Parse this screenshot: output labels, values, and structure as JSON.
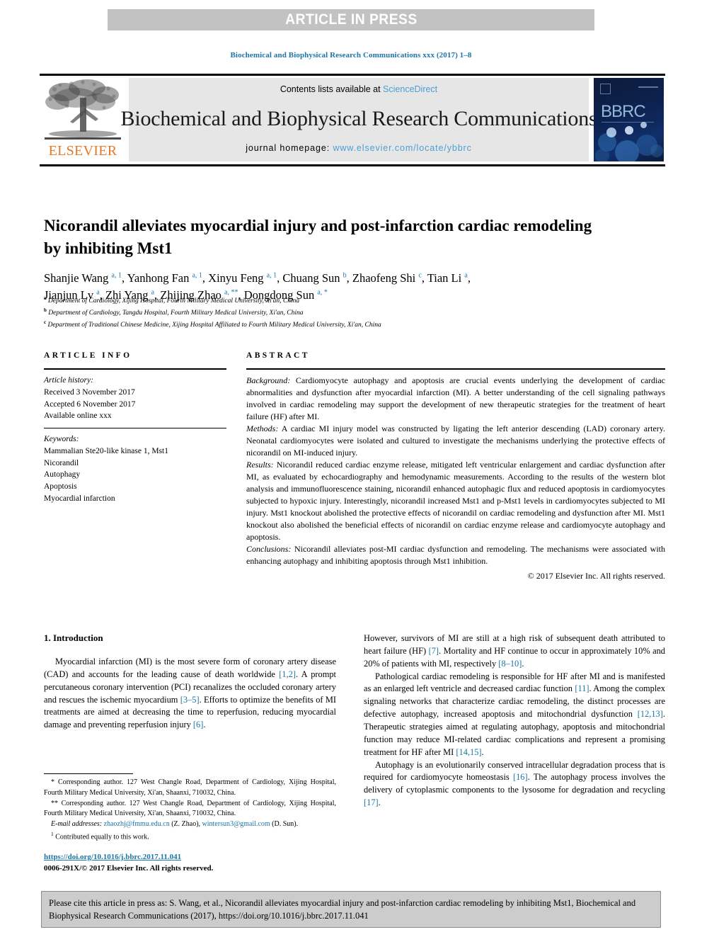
{
  "banner": {
    "label": "ARTICLE IN PRESS"
  },
  "running_head": "Biochemical and Biophysical Research Communications xxx (2017) 1–8",
  "masthead": {
    "elsevier_wordmark": "ELSEVIER",
    "contents_prefix": "Contents lists available at ",
    "contents_link": "ScienceDirect",
    "journal_title": "Biochemical and Biophysical Research Communications",
    "homepage_prefix": "journal homepage: ",
    "homepage_url": "www.elsevier.com/locate/ybbrc",
    "cover_label": "BBRC"
  },
  "article": {
    "title": "Nicorandil alleviates myocardial injury and post-infarction cardiac remodeling by inhibiting Mst1",
    "authors_line_1": "Shanjie Wang <sup>a, 1</sup>, Yanhong Fan <sup>a, 1</sup>, Xinyu Feng <sup>a, 1</sup>, Chuang Sun <sup>b</sup>, Zhaofeng Shi <sup>c</sup>, Tian Li <sup>a</sup>,",
    "authors_line_2": "Jianjun Lv <sup>a</sup>, Zhi Yang <sup>a</sup>, Zhijing Zhao <sup>a, **</sup>, Dongdong Sun <sup>a, *</sup>",
    "affiliation_a": "<sup>a</sup> Department of Cardiology, Xijing Hospital, Fourth Military Medical University, Xi'an, China",
    "affiliation_b": "<sup>b</sup> Department of Cardiology, Tangdu Hospital, Fourth Military Medical University, Xi'an, China",
    "affiliation_c": "<sup>c</sup> Department of Traditional Chinese Medicine, Xijing Hospital Affiliated to Fourth Military Medical University, Xi'an, China"
  },
  "article_info": {
    "heading": "ARTICLE INFO",
    "history_label": "Article history:",
    "received": "Received 3 November 2017",
    "accepted": "Accepted 6 November 2017",
    "available": "Available online xxx",
    "keywords_label": "Keywords:",
    "keywords": [
      "Mammalian Ste20-like kinase 1, Mst1",
      "Nicorandil",
      "Autophagy",
      "Apoptosis",
      "Myocardial infarction"
    ]
  },
  "abstract": {
    "heading": "ABSTRACT",
    "background_label": "Background:",
    "background": "Cardiomyocyte autophagy and apoptosis are crucial events underlying the development of cardiac abnormalities and dysfunction after myocardial infarction (MI). A better understanding of the cell signaling pathways involved in cardiac remodeling may support the development of new therapeutic strategies for the treatment of heart failure (HF) after MI.",
    "methods_label": "Methods:",
    "methods": "A cardiac MI injury model was constructed by ligating the left anterior descending (LAD) coronary artery. Neonatal cardiomyocytes were isolated and cultured to investigate the mechanisms underlying the protective effects of nicorandil on MI-induced injury.",
    "results_label": "Results:",
    "results": "Nicorandil reduced cardiac enzyme release, mitigated left ventricular enlargement and cardiac dysfunction after MI, as evaluated by echocardiography and hemodynamic measurements. According to the results of the western blot analysis and immunofluorescence staining, nicorandil enhanced autophagic flux and reduced apoptosis in cardiomyocytes subjected to hypoxic injury. Interestingly, nicorandil increased Mst1 and p-Mst1 levels in cardiomyocytes subjected to MI injury. Mst1 knockout abolished the protective effects of nicorandil on cardiac remodeling and dysfunction after MI. Mst1 knockout also abolished the beneficial effects of nicorandil on cardiac enzyme release and cardiomyocyte autophagy and apoptosis.",
    "conclusions_label": "Conclusions:",
    "conclusions": "Nicorandil alleviates post-MI cardiac dysfunction and remodeling. The mechanisms were associated with enhancing autophagy and inhibiting apoptosis through Mst1 inhibition.",
    "copyright": "© 2017 Elsevier Inc. All rights reserved."
  },
  "introduction": {
    "heading": "1. Introduction",
    "left_p1_a": "Myocardial infarction (MI) is the most severe form of coronary artery disease (CAD) and accounts for the leading cause of death worldwide ",
    "left_p1_ref1": "[1,2]",
    "left_p1_b": ". A prompt percutaneous coronary intervention (PCI) recanalizes the occluded coronary artery and rescues the ischemic myocardium ",
    "left_p1_ref2": "[3–5]",
    "left_p1_c": ". Efforts to optimize the benefits of MI treatments are aimed at decreasing the time to reperfusion, reducing myocardial damage and preventing reperfusion injury ",
    "left_p1_ref3": "[6]",
    "left_p1_d": ".",
    "right_p1_a": "However, survivors of MI are still at a high risk of subsequent death attributed to heart failure (HF) ",
    "right_p1_ref1": "[7]",
    "right_p1_b": ". Mortality and HF continue to occur in approximately 10% and 20% of patients with MI, respectively ",
    "right_p1_ref2": "[8–10]",
    "right_p1_c": ".",
    "right_p2_a": "Pathological cardiac remodeling is responsible for HF after MI and is manifested as an enlarged left ventricle and decreased cardiac function ",
    "right_p2_ref1": "[11]",
    "right_p2_b": ". Among the complex signaling networks that characterize cardiac remodeling, the distinct processes are defective autophagy, increased apoptosis and mitochondrial dysfunction ",
    "right_p2_ref2": "[12,13]",
    "right_p2_c": ". Therapeutic strategies aimed at regulating autophagy, apoptosis and mitochondrial function may reduce MI-related cardiac complications and represent a promising treatment for HF after MI ",
    "right_p2_ref3": "[14,15]",
    "right_p2_d": ".",
    "right_p3_a": "Autophagy is an evolutionarily conserved intracellular degradation process that is required for cardiomyocyte homeostasis ",
    "right_p3_ref1": "[16]",
    "right_p3_b": ". The autophagy process involves the delivery of cytoplasmic components to the lysosome for degradation and recycling ",
    "right_p3_ref2": "[17]",
    "right_p3_c": "."
  },
  "footnotes": {
    "corresponding_1": "* Corresponding author. 127 West Changle Road, Department of Cardiology, Xijing Hospital, Fourth Military Medical University, Xi'an, Shaanxi, 710032, China.",
    "corresponding_2": "** Corresponding author. 127 West Changle Road, Department of Cardiology, Xijing Hospital, Fourth Military Medical University, Xi'an, Shaanxi, 710032, China.",
    "email_label": "E-mail addresses:",
    "email_1": "zhaozhj@fmmu.edu.cn",
    "email_1_who": "(Z. Zhao),",
    "email_2": "wintersun3@gmail.com",
    "email_2_who": "(D. Sun).",
    "equal_contrib": "Contributed equally to this work.",
    "equal_contrib_marker": "1"
  },
  "doi_block": {
    "doi_url": "https://doi.org/10.1016/j.bbrc.2017.11.041",
    "issn_line": "0006-291X/© 2017 Elsevier Inc. All rights reserved."
  },
  "citation_box": {
    "text": "Please cite this article in press as: S. Wang, et al., Nicorandil alleviates myocardial injury and post-infarction cardiac remodeling by inhibiting Mst1, Biochemical and Biophysical Research Communications (2017), https://doi.org/10.1016/j.bbrc.2017.11.041"
  },
  "colors": {
    "link_blue": "#1a75a8",
    "sciencedirect_blue": "#4a9fd5",
    "elsevier_orange": "#e87722",
    "banner_gray": "#c2c2c2",
    "band_gray": "#e6e6e6",
    "cite_box_gray": "#cccccc"
  }
}
